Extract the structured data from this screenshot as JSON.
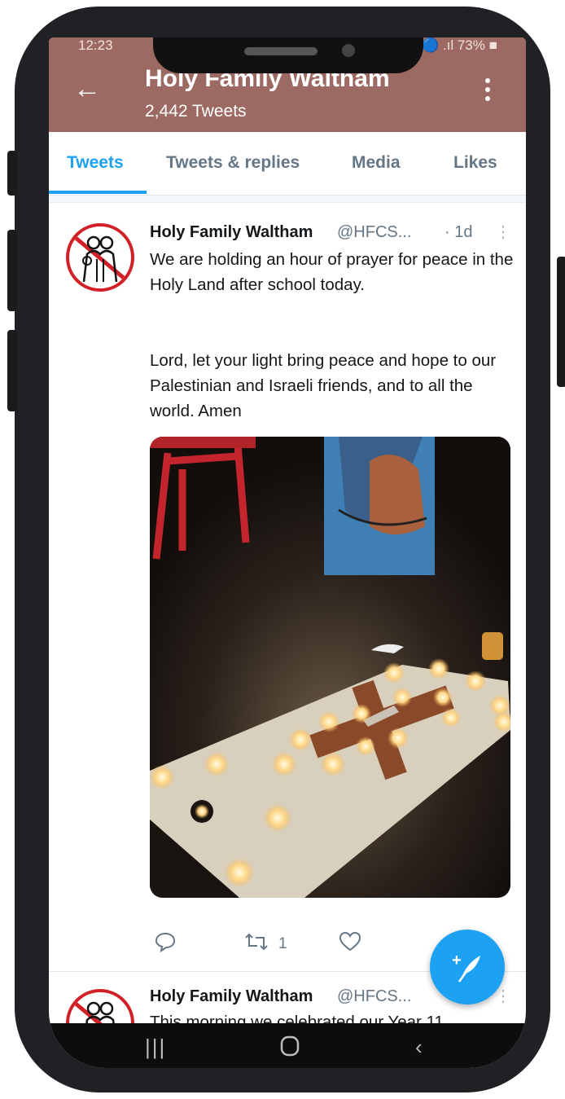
{
  "status_bar": {
    "time": "12:23",
    "right": "🔵 .ıl 73% ■"
  },
  "header": {
    "back_icon": "back-arrow-icon",
    "title": "Holy Family Waltham",
    "subtitle": "2,442 Tweets",
    "menu_icon": "more-vert-icon",
    "color": "#9c6a62"
  },
  "tabs": [
    {
      "label": "Tweets",
      "active": true
    },
    {
      "label": "Tweets & replies",
      "active": false
    },
    {
      "label": "Media",
      "active": false
    },
    {
      "label": "Likes",
      "active": false
    }
  ],
  "tweets": [
    {
      "name": "Holy Family Waltham",
      "handle": "@HFCS...",
      "time": "· 1d",
      "text_p1": "We are holding an hour of prayer for peace in the Holy Land after school today.",
      "text_p2": "Lord, let your light bring peace and hope to our Palestinian and Israeli friends, and to all the world. Amen",
      "retweet_count": "1"
    },
    {
      "name": "Holy Family Waltham",
      "handle": "@HFCS...",
      "text_p1": "This morning we celebrated our Year 11"
    }
  ],
  "colors": {
    "accent": "#1da1f2",
    "text": "#14171a",
    "muted": "#657786"
  },
  "nav": {
    "recents": "|||",
    "home": "○",
    "back": "‹"
  }
}
